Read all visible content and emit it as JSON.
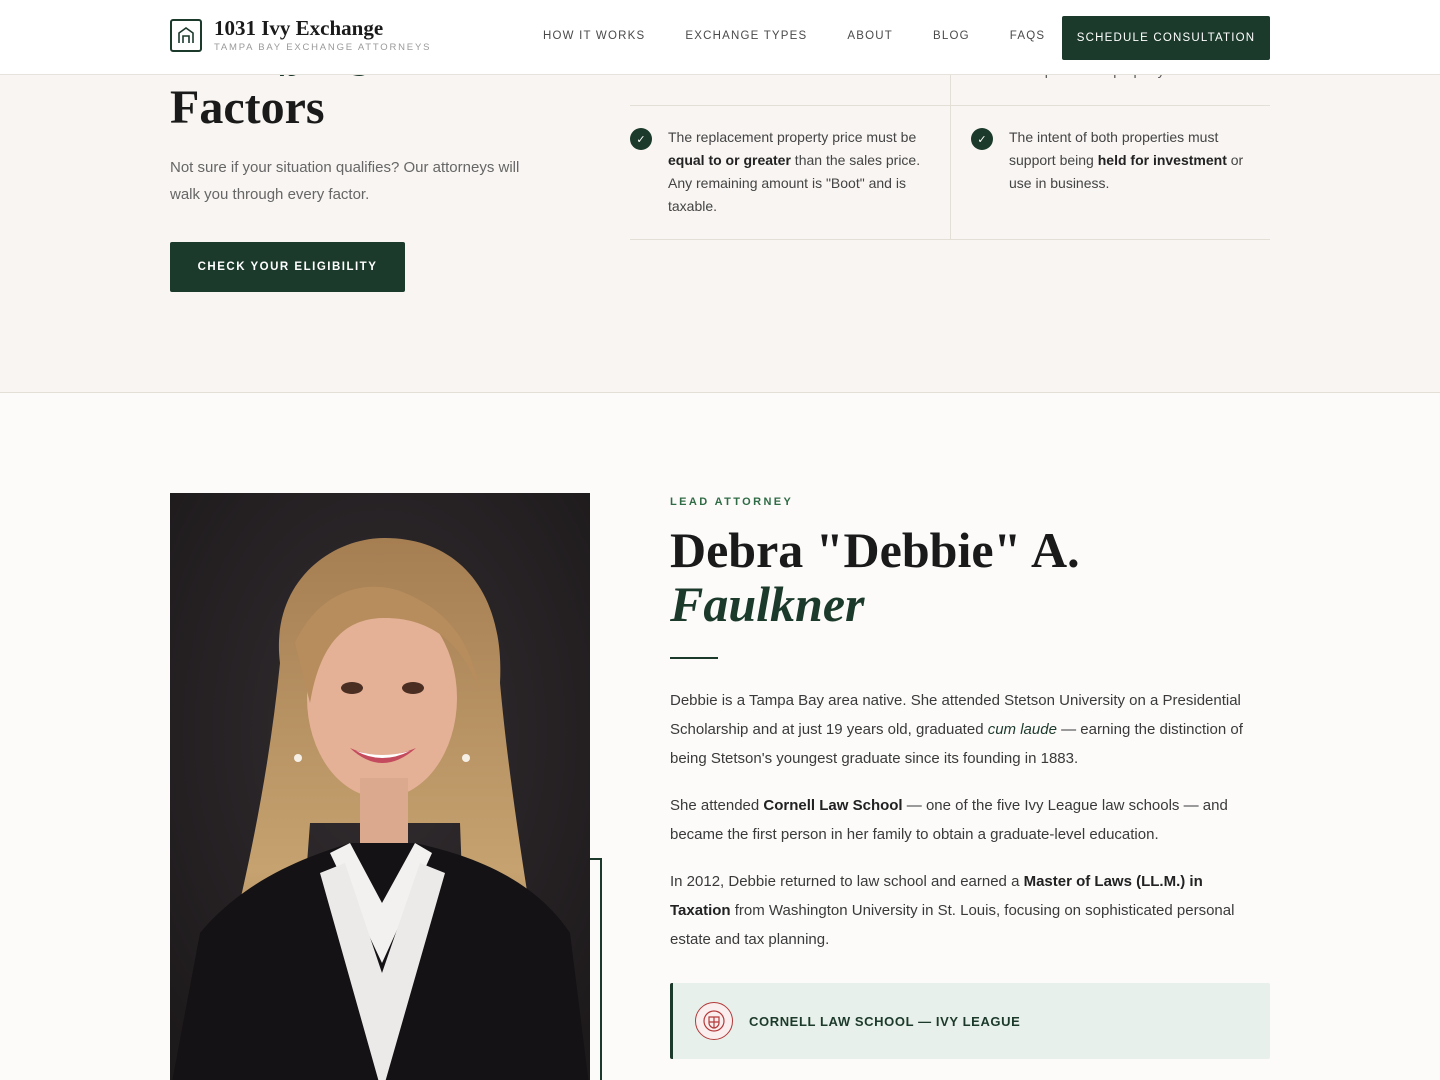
{
  "header": {
    "brand_title": "1031 Ivy Exchange",
    "brand_subtitle": "TAMPA BAY EXCHANGE ATTORNEYS",
    "nav": [
      "HOW IT WORKS",
      "EXCHANGE TYPES",
      "ABOUT",
      "BLOG",
      "FAQS"
    ],
    "cta_label": "SCHEDULE CONSULTATION"
  },
  "factors": {
    "title_line2": "Factors",
    "lead": "Not sure if your situation qualifies? Our attorneys will walk you through every factor.",
    "button_label": "CHECK YOUR ELIGIBILITY",
    "cut_text": "the replacement property.",
    "items": [
      {
        "pre": "The replacement property price must be ",
        "bold": "equal to or greater",
        "post": " than the sales price. Any remaining amount is \"Boot\" and is taxable."
      },
      {
        "pre": "The intent of both properties must support being ",
        "bold": "held for investment",
        "post": " or use in business."
      }
    ],
    "check_glyph": "✓"
  },
  "attorney": {
    "eyebrow": "LEAD ATTORNEY",
    "name_first": "Debra \"Debbie\" A.",
    "name_last": "Faulkner",
    "bio": {
      "p1_a": "Debbie is a Tampa Bay area native. She attended Stetson University on a Presidential Scholarship and at just 19 years old, graduated ",
      "p1_em": "cum laude",
      "p1_b": " — earning the distinction of being Stetson's youngest graduate since its founding in 1883.",
      "p2_a": "She attended ",
      "p2_bold": "Cornell Law School",
      "p2_b": " — one of the five Ivy League law schools — and became the first person in her family to obtain a graduate-level education.",
      "p3_a": "In 2012, Debbie returned to law school and earned a ",
      "p3_bold": "Master of Laws (LL.M.) in Taxation",
      "p3_b": " from Washington University in St. Louis, focusing on sophisticated personal estate and tax planning."
    },
    "credential_label": "CORNELL LAW SCHOOL — IVY LEAGUE"
  },
  "colors": {
    "brand_green": "#1c3a2c",
    "accent_green": "#2f6b45",
    "section_bg": "#f8f5f2",
    "credential_bg": "#e7f0ea",
    "seal_red": "#b33a3a"
  },
  "icons": [
    "house-logo-icon",
    "check-icon",
    "cornell-seal-icon"
  ]
}
